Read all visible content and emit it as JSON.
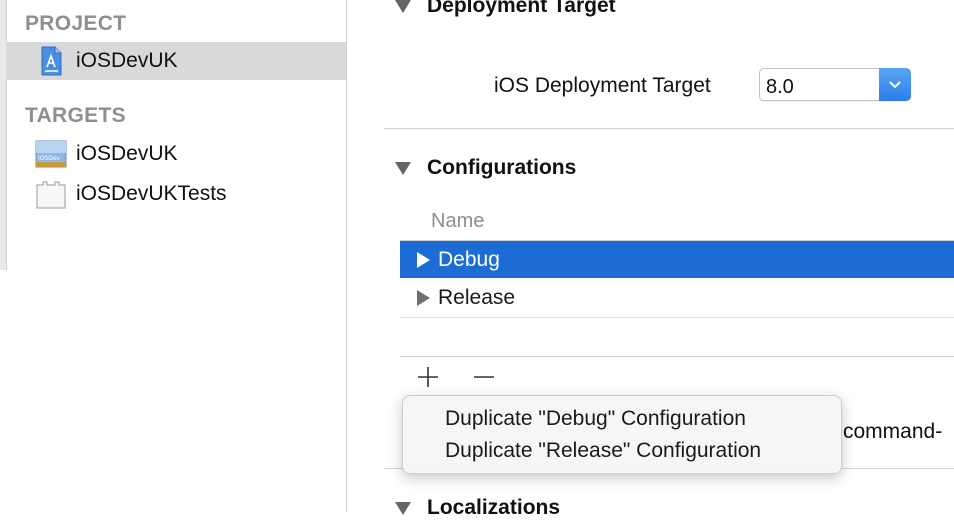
{
  "sidebar": {
    "project_header": "PROJECT",
    "project_item": "iOSDevUK",
    "targets_header": "TARGETS",
    "targets": [
      {
        "label": "iOSDevUK",
        "icon": "app-target-icon"
      },
      {
        "label": "iOSDevUKTests",
        "icon": "test-bundle-icon"
      }
    ]
  },
  "deployment": {
    "header": "Deployment Target",
    "field_label": "iOS Deployment Target",
    "value": "8.0"
  },
  "configurations": {
    "header": "Configurations",
    "column_name": "Name",
    "rows": [
      {
        "label": "Debug",
        "selected": true
      },
      {
        "label": "Release",
        "selected": false
      }
    ],
    "add_symbol": "+",
    "remove_symbol": "−",
    "trailing_text": "command-"
  },
  "menu": {
    "items": [
      "Duplicate \"Debug\" Configuration",
      "Duplicate \"Release\" Configuration"
    ]
  },
  "localizations": {
    "header": "Localizations"
  },
  "colors": {
    "selection_blue": "#1d6cd6",
    "sidebar_selected": "#d9d9d9",
    "header_gray": "#8e8e93"
  }
}
